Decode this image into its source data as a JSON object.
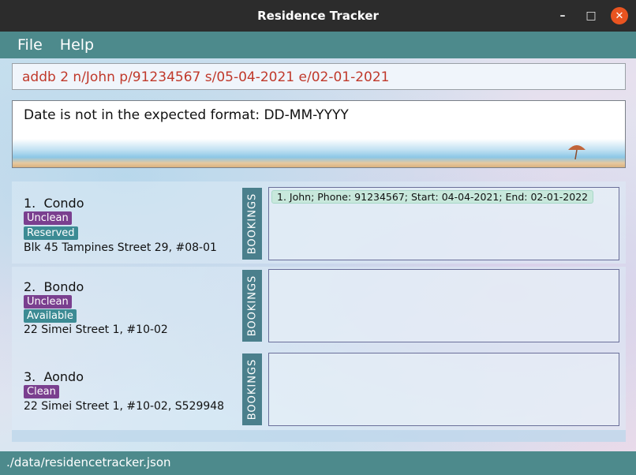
{
  "window": {
    "title": "Residence Tracker"
  },
  "menu": {
    "items": [
      "File",
      "Help"
    ]
  },
  "command": {
    "value": "addb 2 n/John p/91234567 s/05-04-2021 e/02-01-2021"
  },
  "result": {
    "message": "Date is not in the expected format: DD-MM-YYYY"
  },
  "bookings_label": "BOOKINGS",
  "residences": [
    {
      "index": "1.",
      "name": "Condo",
      "clean_tag": "Unclean",
      "booking_tag": "Reserved",
      "address": "Blk 45 Tampines Street 29, #08-01",
      "bookings": [
        "1. John; Phone: 91234567; Start: 04-04-2021; End: 02-01-2022"
      ]
    },
    {
      "index": "2.",
      "name": "Bondo",
      "clean_tag": "Unclean",
      "booking_tag": "Available",
      "address": "22 Simei Street 1, #10-02",
      "bookings": []
    },
    {
      "index": "3.",
      "name": "Aondo",
      "clean_tag": "Clean",
      "booking_tag": "",
      "address": "22 Simei Street 1, #10-02, S529948",
      "bookings": []
    }
  ],
  "status": {
    "file_path": "./data/residencetracker.json"
  },
  "colors": {
    "titlebar": "#2c2c2c",
    "menubar": "#4d8a8c",
    "error_text": "#c0392b",
    "tag_purple": "#7a3f8f",
    "tag_teal": "#3c8b94",
    "close_button": "#e95420"
  }
}
